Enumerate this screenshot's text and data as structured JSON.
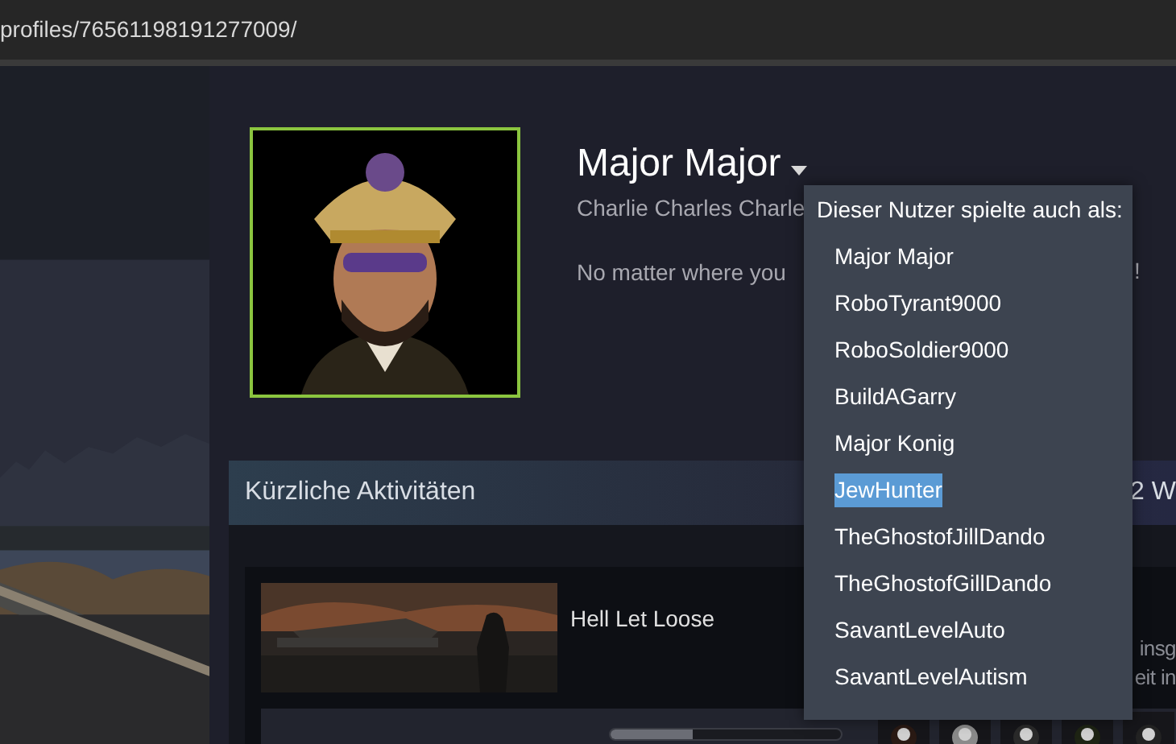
{
  "address_bar": {
    "url": "profiles/76561198191277009/"
  },
  "profile": {
    "name": "Major Major",
    "real_name": "Charlie Charles Charle",
    "summary": "No matter where you",
    "summary_end": "!"
  },
  "aliases_menu": {
    "title": "Dieser Nutzer spielte auch als:",
    "items": [
      {
        "label": "Major Major",
        "selected": false
      },
      {
        "label": "RoboTyrant9000",
        "selected": false
      },
      {
        "label": "RoboSoldier9000",
        "selected": false
      },
      {
        "label": "BuildAGarry",
        "selected": false
      },
      {
        "label": "Major Konig",
        "selected": false
      },
      {
        "label": "JewHunter",
        "selected": true
      },
      {
        "label": "TheGhostofJillDando",
        "selected": false
      },
      {
        "label": "TheGhostofGillDando",
        "selected": false
      },
      {
        "label": "SavantLevelAuto",
        "selected": false
      },
      {
        "label": "SavantLevelAutism",
        "selected": false
      }
    ]
  },
  "recent_activity": {
    "title": "Kürzliche Aktivitäten",
    "header_right": "2 W",
    "game": {
      "title": "Hell Let Loose",
      "stats_line_1": "insg",
      "stats_line_2": "eit in",
      "achievement_progress": {
        "level": 0.36
      }
    }
  }
}
